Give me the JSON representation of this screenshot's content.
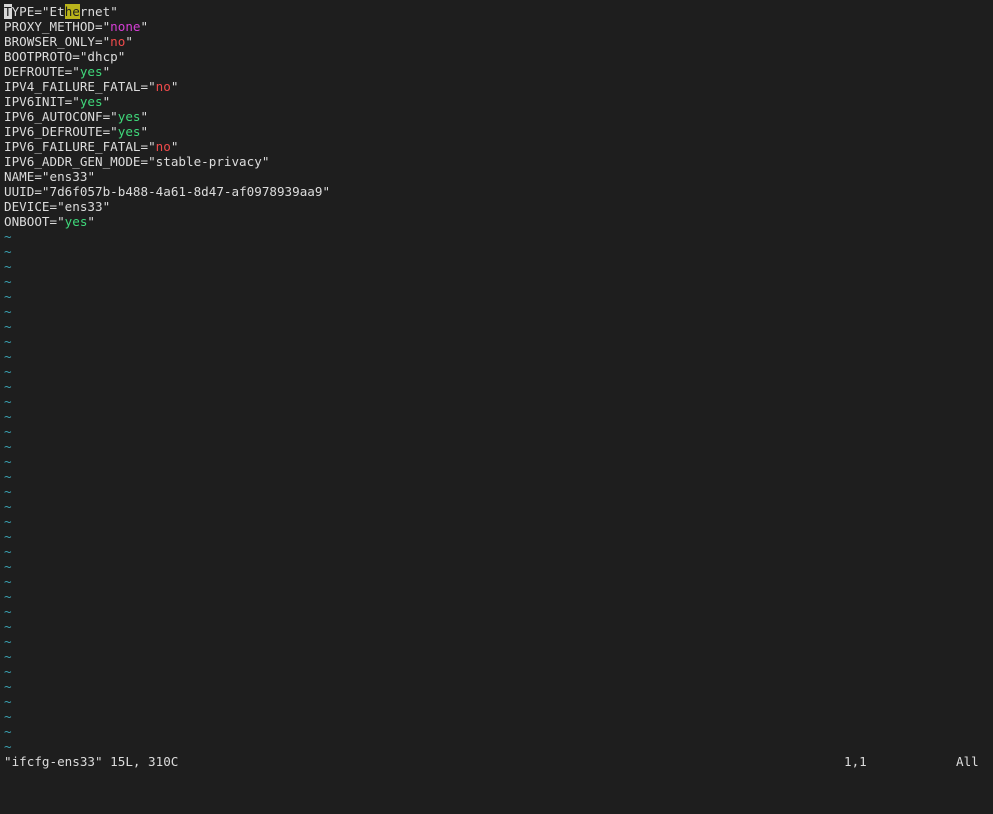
{
  "editor": {
    "lines": [
      {
        "key": "TYPE",
        "value": "Ethernet",
        "style": "plain"
      },
      {
        "key": "PROXY_METHOD",
        "value": "none",
        "style": "none"
      },
      {
        "key": "BROWSER_ONLY",
        "value": "no",
        "style": "no"
      },
      {
        "key": "BOOTPROTO",
        "value": "dhcp",
        "style": "plain"
      },
      {
        "key": "DEFROUTE",
        "value": "yes",
        "style": "yes"
      },
      {
        "key": "IPV4_FAILURE_FATAL",
        "value": "no",
        "style": "no"
      },
      {
        "key": "IPV6INIT",
        "value": "yes",
        "style": "yes"
      },
      {
        "key": "IPV6_AUTOCONF",
        "value": "yes",
        "style": "yes"
      },
      {
        "key": "IPV6_DEFROUTE",
        "value": "yes",
        "style": "yes"
      },
      {
        "key": "IPV6_FAILURE_FATAL",
        "value": "no",
        "style": "no"
      },
      {
        "key": "IPV6_ADDR_GEN_MODE",
        "value": "stable-privacy",
        "style": "plain"
      },
      {
        "key": "NAME",
        "value": "ens33",
        "style": "plain"
      },
      {
        "key": "UUID",
        "value": "7d6f057b-b488-4a61-8d47-af0978939aa9",
        "style": "plain"
      },
      {
        "key": "DEVICE",
        "value": "ens33",
        "style": "plain"
      },
      {
        "key": "ONBOOT",
        "value": "yes",
        "style": "yes"
      }
    ],
    "first_line_parts": {
      "cursor_char": "T",
      "key_rest": "YPE",
      "eq_quote": "=\"",
      "value_pre": "Et",
      "value_highlight": "he",
      "value_post": "rnet",
      "close_quote": "\""
    },
    "empty_line_marker": "~",
    "empty_line_count": 35
  },
  "statusbar": {
    "file_info": "\"ifcfg-ens33\" 15L, 310C",
    "cursor_position": "1,1",
    "scroll_position": "All"
  },
  "colors": {
    "background": "#1e1e1e",
    "text": "#dcdcdc",
    "yes_value": "#3fd87a",
    "no_value": "#f04b4b",
    "none_value": "#d63fd6",
    "tilde": "#3aa0b0",
    "search_highlight": "#b9b31b"
  }
}
